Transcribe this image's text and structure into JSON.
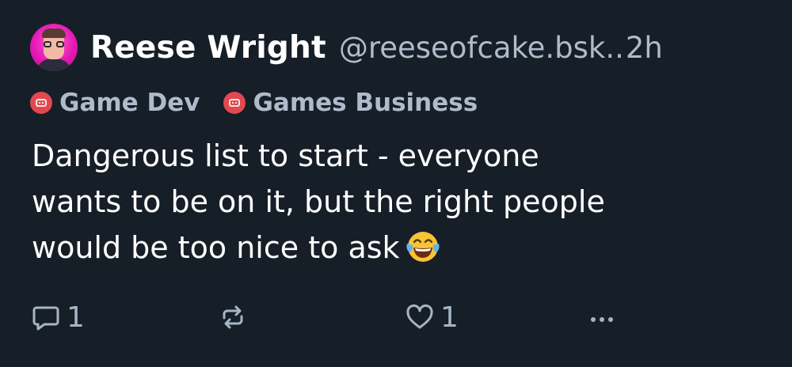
{
  "post": {
    "author": {
      "display_name": "Reese Wright",
      "handle": "@reeseofcake.bsk..",
      "time": "2h",
      "avatar_colors": {
        "background": "#e419b4"
      }
    },
    "tags": [
      {
        "label": "Game Dev",
        "icon": "gamepad-icon",
        "color": "#e2484f"
      },
      {
        "label": "Games Business",
        "icon": "gamepad-icon",
        "color": "#e2484f"
      }
    ],
    "text": "Dangerous list to start - everyone\nwants to be on it, but the right people\nwould be too nice to ask",
    "emoji": "face-with-tears-of-joy",
    "actions": {
      "reply": {
        "icon": "reply-icon",
        "count": "1"
      },
      "repost": {
        "icon": "repost-icon",
        "count": ""
      },
      "like": {
        "icon": "heart-icon",
        "count": "1"
      },
      "more": {
        "icon": "more-icon"
      }
    }
  },
  "colors": {
    "background": "#161e27",
    "secondary_text": "#aebbcb",
    "tag_accent": "#e2484f"
  }
}
